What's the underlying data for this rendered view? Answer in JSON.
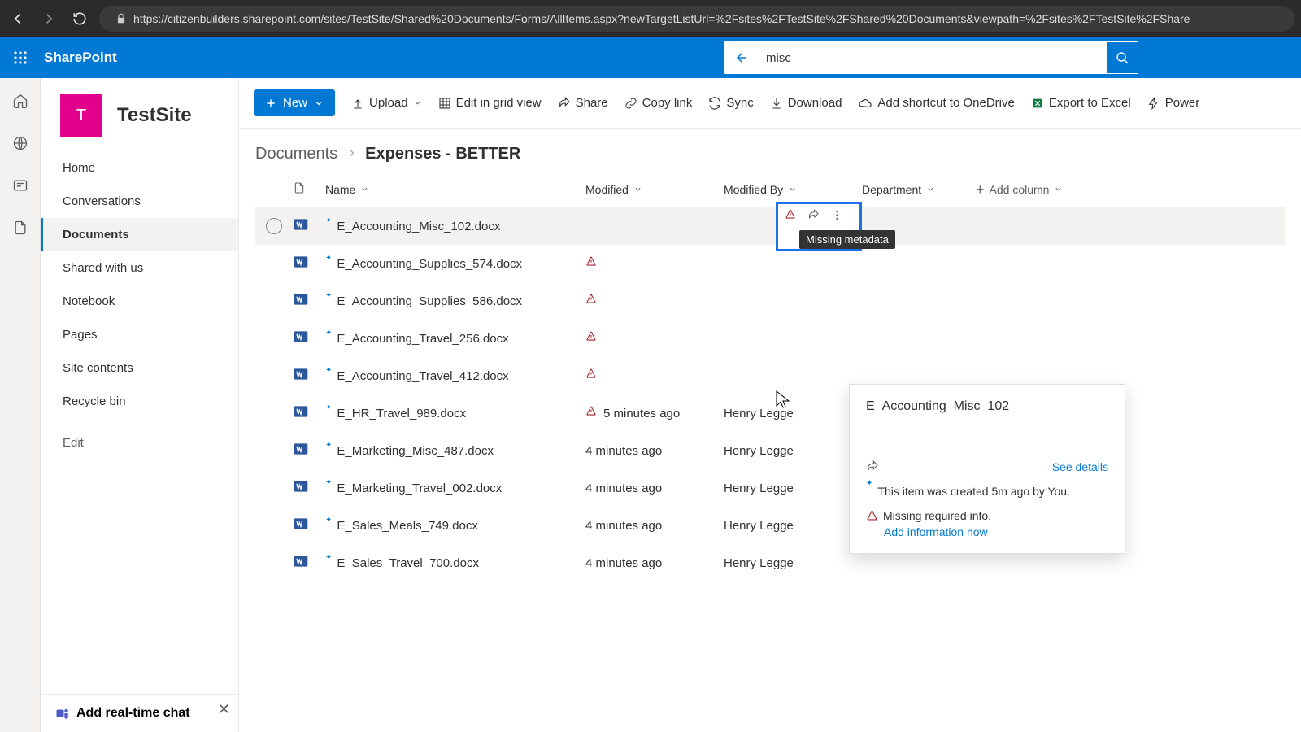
{
  "browser": {
    "url": "https://citizenbuilders.sharepoint.com/sites/TestSite/Shared%20Documents/Forms/AllItems.aspx?newTargetListUrl=%2Fsites%2FTestSite%2FShared%20Documents&viewpath=%2Fsites%2FTestSite%2FShare"
  },
  "suite": {
    "brand": "SharePoint",
    "search_value": "misc"
  },
  "site": {
    "logo_letter": "T",
    "title": "TestSite"
  },
  "nav": {
    "items": [
      "Home",
      "Conversations",
      "Documents",
      "Shared with us",
      "Notebook",
      "Pages",
      "Site contents",
      "Recycle bin"
    ],
    "selected_index": 2,
    "edit": "Edit",
    "chat_prompt": "Add real-time chat"
  },
  "commands": {
    "new": "New",
    "upload": "Upload",
    "editgrid": "Edit in grid view",
    "share": "Share",
    "copylink": "Copy link",
    "sync": "Sync",
    "download": "Download",
    "shortcut": "Add shortcut to OneDrive",
    "export": "Export to Excel",
    "power": "Power"
  },
  "breadcrumb": {
    "root": "Documents",
    "leaf": "Expenses - BETTER"
  },
  "columns": {
    "name": "Name",
    "modified": "Modified",
    "modifiedby": "Modified By",
    "department": "Department",
    "add": "Add column"
  },
  "rows": [
    {
      "name": "E_Accounting_Misc_102.docx",
      "modified": "",
      "by": ""
    },
    {
      "name": "E_Accounting_Supplies_574.docx",
      "modified": "",
      "by": ""
    },
    {
      "name": "E_Accounting_Supplies_586.docx",
      "modified": "",
      "by": ""
    },
    {
      "name": "E_Accounting_Travel_256.docx",
      "modified": "",
      "by": ""
    },
    {
      "name": "E_Accounting_Travel_412.docx",
      "modified": "",
      "by": ""
    },
    {
      "name": "E_HR_Travel_989.docx",
      "modified": "5 minutes ago",
      "by": "Henry Legge"
    },
    {
      "name": "E_Marketing_Misc_487.docx",
      "modified": "4 minutes ago",
      "by": "Henry Legge"
    },
    {
      "name": "E_Marketing_Travel_002.docx",
      "modified": "4 minutes ago",
      "by": "Henry Legge"
    },
    {
      "name": "E_Sales_Meals_749.docx",
      "modified": "4 minutes ago",
      "by": "Henry Legge"
    },
    {
      "name": "E_Sales_Travel_700.docx",
      "modified": "4 minutes ago",
      "by": "Henry Legge"
    }
  ],
  "tooltip": "Missing metadata",
  "hovercard": {
    "title": "E_Accounting_Misc_102",
    "see": "See details",
    "created": "This item was created 5m ago by You.",
    "missing": "Missing required info.",
    "addnow": "Add information now"
  }
}
